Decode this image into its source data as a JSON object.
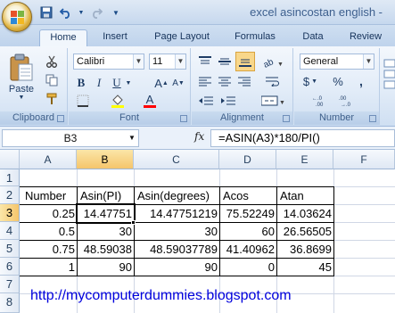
{
  "window": {
    "title": "excel asincostan english -",
    "qat": [
      "save-icon",
      "undo-icon",
      "redo-icon",
      "customize-icon"
    ]
  },
  "ribbon_tabs": [
    "Home",
    "Insert",
    "Page Layout",
    "Formulas",
    "Data",
    "Review"
  ],
  "active_tab": "Home",
  "clipboard": {
    "paste_label": "Paste",
    "group_label": "Clipboard"
  },
  "font": {
    "name": "Calibri",
    "size": "11",
    "group_label": "Font"
  },
  "alignment": {
    "group_label": "Alignment"
  },
  "number": {
    "format": "General",
    "dollar": "$",
    "percent": "%",
    "group_label": "Number"
  },
  "formula_bar": {
    "name_box": "B3",
    "fx": "fx",
    "formula": "=ASIN(A3)*180/PI()"
  },
  "sheet": {
    "columns": [
      "A",
      "B",
      "C",
      "D",
      "E",
      "F"
    ],
    "rows": [
      "1",
      "2",
      "3",
      "4",
      "5",
      "6",
      "7",
      "8"
    ],
    "selected_column": "B",
    "selected_row": "3",
    "headers": [
      "Number",
      "Asin(PI)",
      "Asin(degrees)",
      "Acos",
      "Atan"
    ],
    "data": [
      [
        "0.25",
        "14.47751",
        "14.47751219",
        "75.52249",
        "14.03624"
      ],
      [
        "0.5",
        "30",
        "30",
        "60",
        "26.56505"
      ],
      [
        "0.75",
        "48.59038",
        "48.59037789",
        "41.40962",
        "36.8699"
      ],
      [
        "1",
        "90",
        "90",
        "0",
        "45"
      ]
    ],
    "link_text": "http://mycomputerdummies.blogspot.com"
  },
  "colors": {
    "accent": "#c6d8ee",
    "selection": "#f5c56b",
    "link": "#0000dd"
  }
}
